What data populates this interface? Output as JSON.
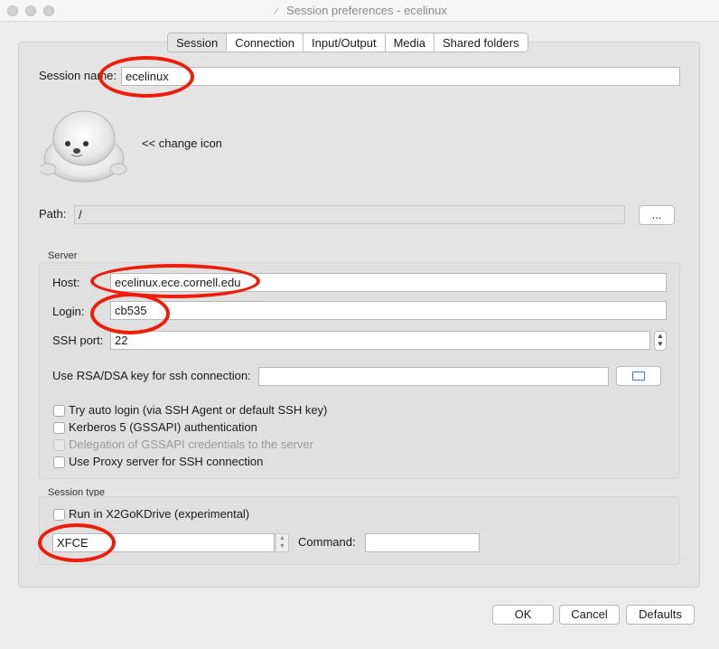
{
  "window": {
    "title": "Session preferences - ecelinux"
  },
  "tabs": [
    "Session",
    "Connection",
    "Input/Output",
    "Media",
    "Shared folders"
  ],
  "session": {
    "name_label": "Session name:",
    "name_value": "ecelinux",
    "change_icon_label": "<< change icon",
    "path_label": "Path:",
    "path_value": "/",
    "browse_label": "..."
  },
  "server": {
    "group_title": "Server",
    "host_label": "Host:",
    "host_value": "ecelinux.ece.cornell.edu",
    "login_label": "Login:",
    "login_value": "cb535",
    "ssh_port_label": "SSH port:",
    "ssh_port_value": "22",
    "key_label": "Use RSA/DSA key for ssh connection:",
    "key_value": "",
    "checkboxes": [
      {
        "label": "Try auto login (via SSH Agent or default SSH key)",
        "checked": false,
        "enabled": true
      },
      {
        "label": "Kerberos 5 (GSSAPI) authentication",
        "checked": false,
        "enabled": true
      },
      {
        "label": "Delegation of GSSAPI credentials to the server",
        "checked": false,
        "enabled": false
      },
      {
        "label": "Use Proxy server for SSH connection",
        "checked": false,
        "enabled": true
      }
    ]
  },
  "session_type": {
    "group_title": "Session type",
    "x2gokdrive_label": "Run in X2GoKDrive (experimental)",
    "type_value": "XFCE",
    "command_label": "Command:",
    "command_value": ""
  },
  "footer": {
    "ok_label": "OK",
    "cancel_label": "Cancel",
    "defaults_label": "Defaults"
  },
  "colors": {
    "annotation": "#ee1c0a",
    "window_bg": "#ececec",
    "panel_bg": "#e4e4e4"
  },
  "icons": {
    "session_icon": "seal-icon",
    "folder_button": "folder-icon"
  }
}
